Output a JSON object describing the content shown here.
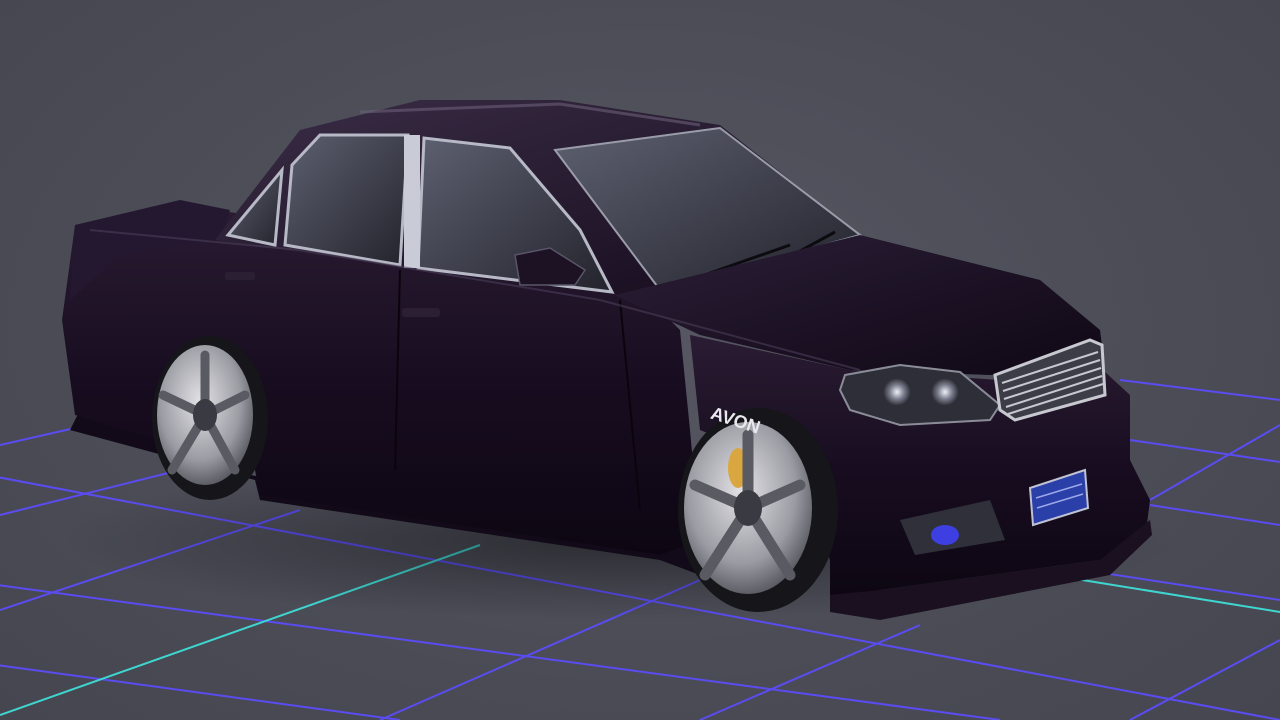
{
  "scene": {
    "background_color": "#4d4e58",
    "grid": {
      "line_color": "#5a4cf0",
      "axis_color": "#3fd6d0"
    },
    "car": {
      "model": "sedan",
      "paint_color": "#1b0f22",
      "tire_text": "AVON",
      "caliper_color": "#d9a640"
    }
  }
}
